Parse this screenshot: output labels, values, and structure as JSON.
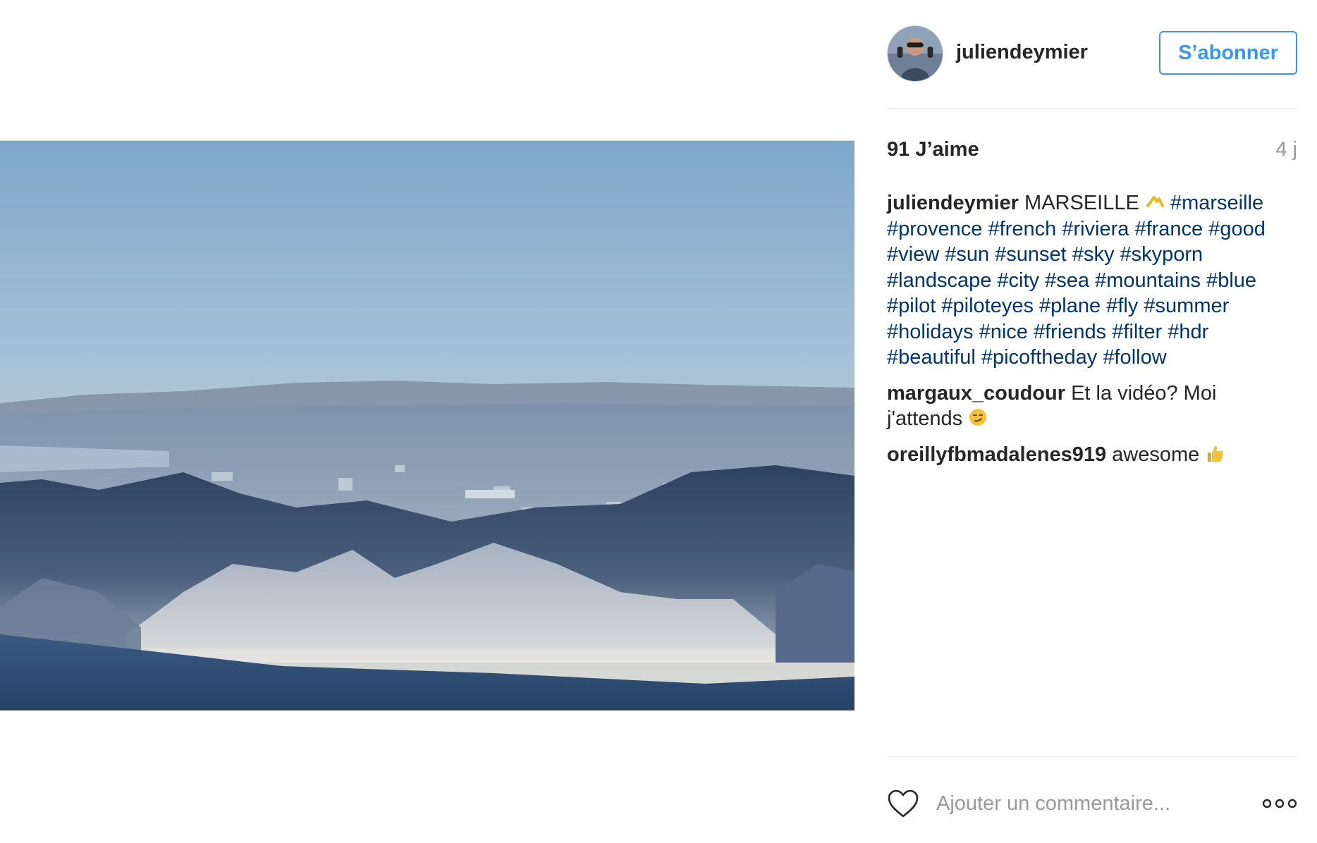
{
  "post": {
    "username": "juliendeymier",
    "follow_label": "S’abonner",
    "likes": "91 J’aime",
    "time_ago": "4 j",
    "caption": {
      "author": "juliendeymier",
      "text": "MARSEILLE",
      "emoji": "yellow-chevron-emoji",
      "hashtags": [
        "#marseille",
        "#provence",
        "#french",
        "#riviera",
        "#france",
        "#good",
        "#view",
        "#sun",
        "#sunset",
        "#sky",
        "#skyporn",
        "#landscape",
        "#city",
        "#sea",
        "#mountains",
        "#blue",
        "#pilot",
        "#piloteyes",
        "#plane",
        "#fly",
        "#summer",
        "#holidays",
        "#nice",
        "#friends",
        "#filter",
        "#hdr",
        "#beautiful",
        "#picoftheday",
        "#follow"
      ]
    },
    "comments": [
      {
        "author": "margaux_coudour",
        "text": "Et la vidéo? Moi j'attends",
        "emoji": "smirking-face-emoji"
      },
      {
        "author": "oreillyfbmadalenes919",
        "text": "awesome",
        "emoji": "thumbs-up-emoji"
      }
    ]
  },
  "comment_bar": {
    "placeholder": "Ajouter un commentaire...",
    "like_icon": "heart-outline-icon",
    "more_icon": "more-options-icon"
  },
  "colors": {
    "accent": "#3897f0",
    "hashtag": "#003569",
    "text": "#262626",
    "muted": "#999999",
    "divider": "#efefef"
  }
}
